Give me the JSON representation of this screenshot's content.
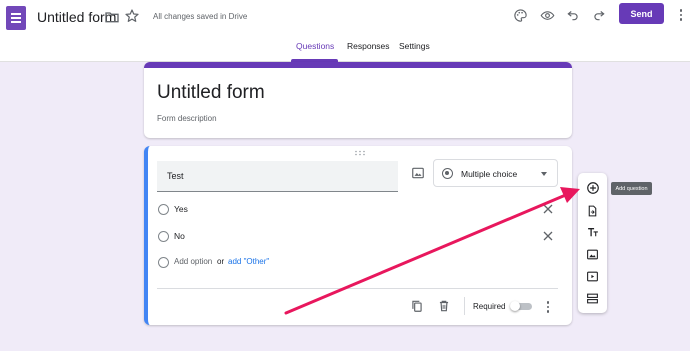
{
  "header": {
    "title": "Untitled form",
    "saved_status": "All changes saved in Drive",
    "send_label": "Send"
  },
  "tabs": [
    {
      "label": "Questions",
      "active": true
    },
    {
      "label": "Responses",
      "active": false
    },
    {
      "label": "Settings",
      "active": false
    }
  ],
  "form": {
    "title": "Untitled form",
    "description_placeholder": "Form description"
  },
  "question": {
    "text": "Test",
    "type": "Multiple choice",
    "options": [
      {
        "label": "Yes"
      },
      {
        "label": "No"
      }
    ],
    "add_option": "Add option",
    "or": "or",
    "add_other": "add \"Other\"",
    "required_label": "Required",
    "required": false
  },
  "toolbar": {
    "tooltip": "Add question",
    "tools": [
      "add-question-icon",
      "import-questions-icon",
      "add-title-icon",
      "add-image-icon",
      "add-video-icon",
      "add-section-icon"
    ]
  },
  "colors": {
    "accent": "#673ab7",
    "background": "#f0ebf8",
    "question_border": "#4285f4",
    "annotation_arrow": "#e8175d",
    "link": "#1a73e8"
  }
}
